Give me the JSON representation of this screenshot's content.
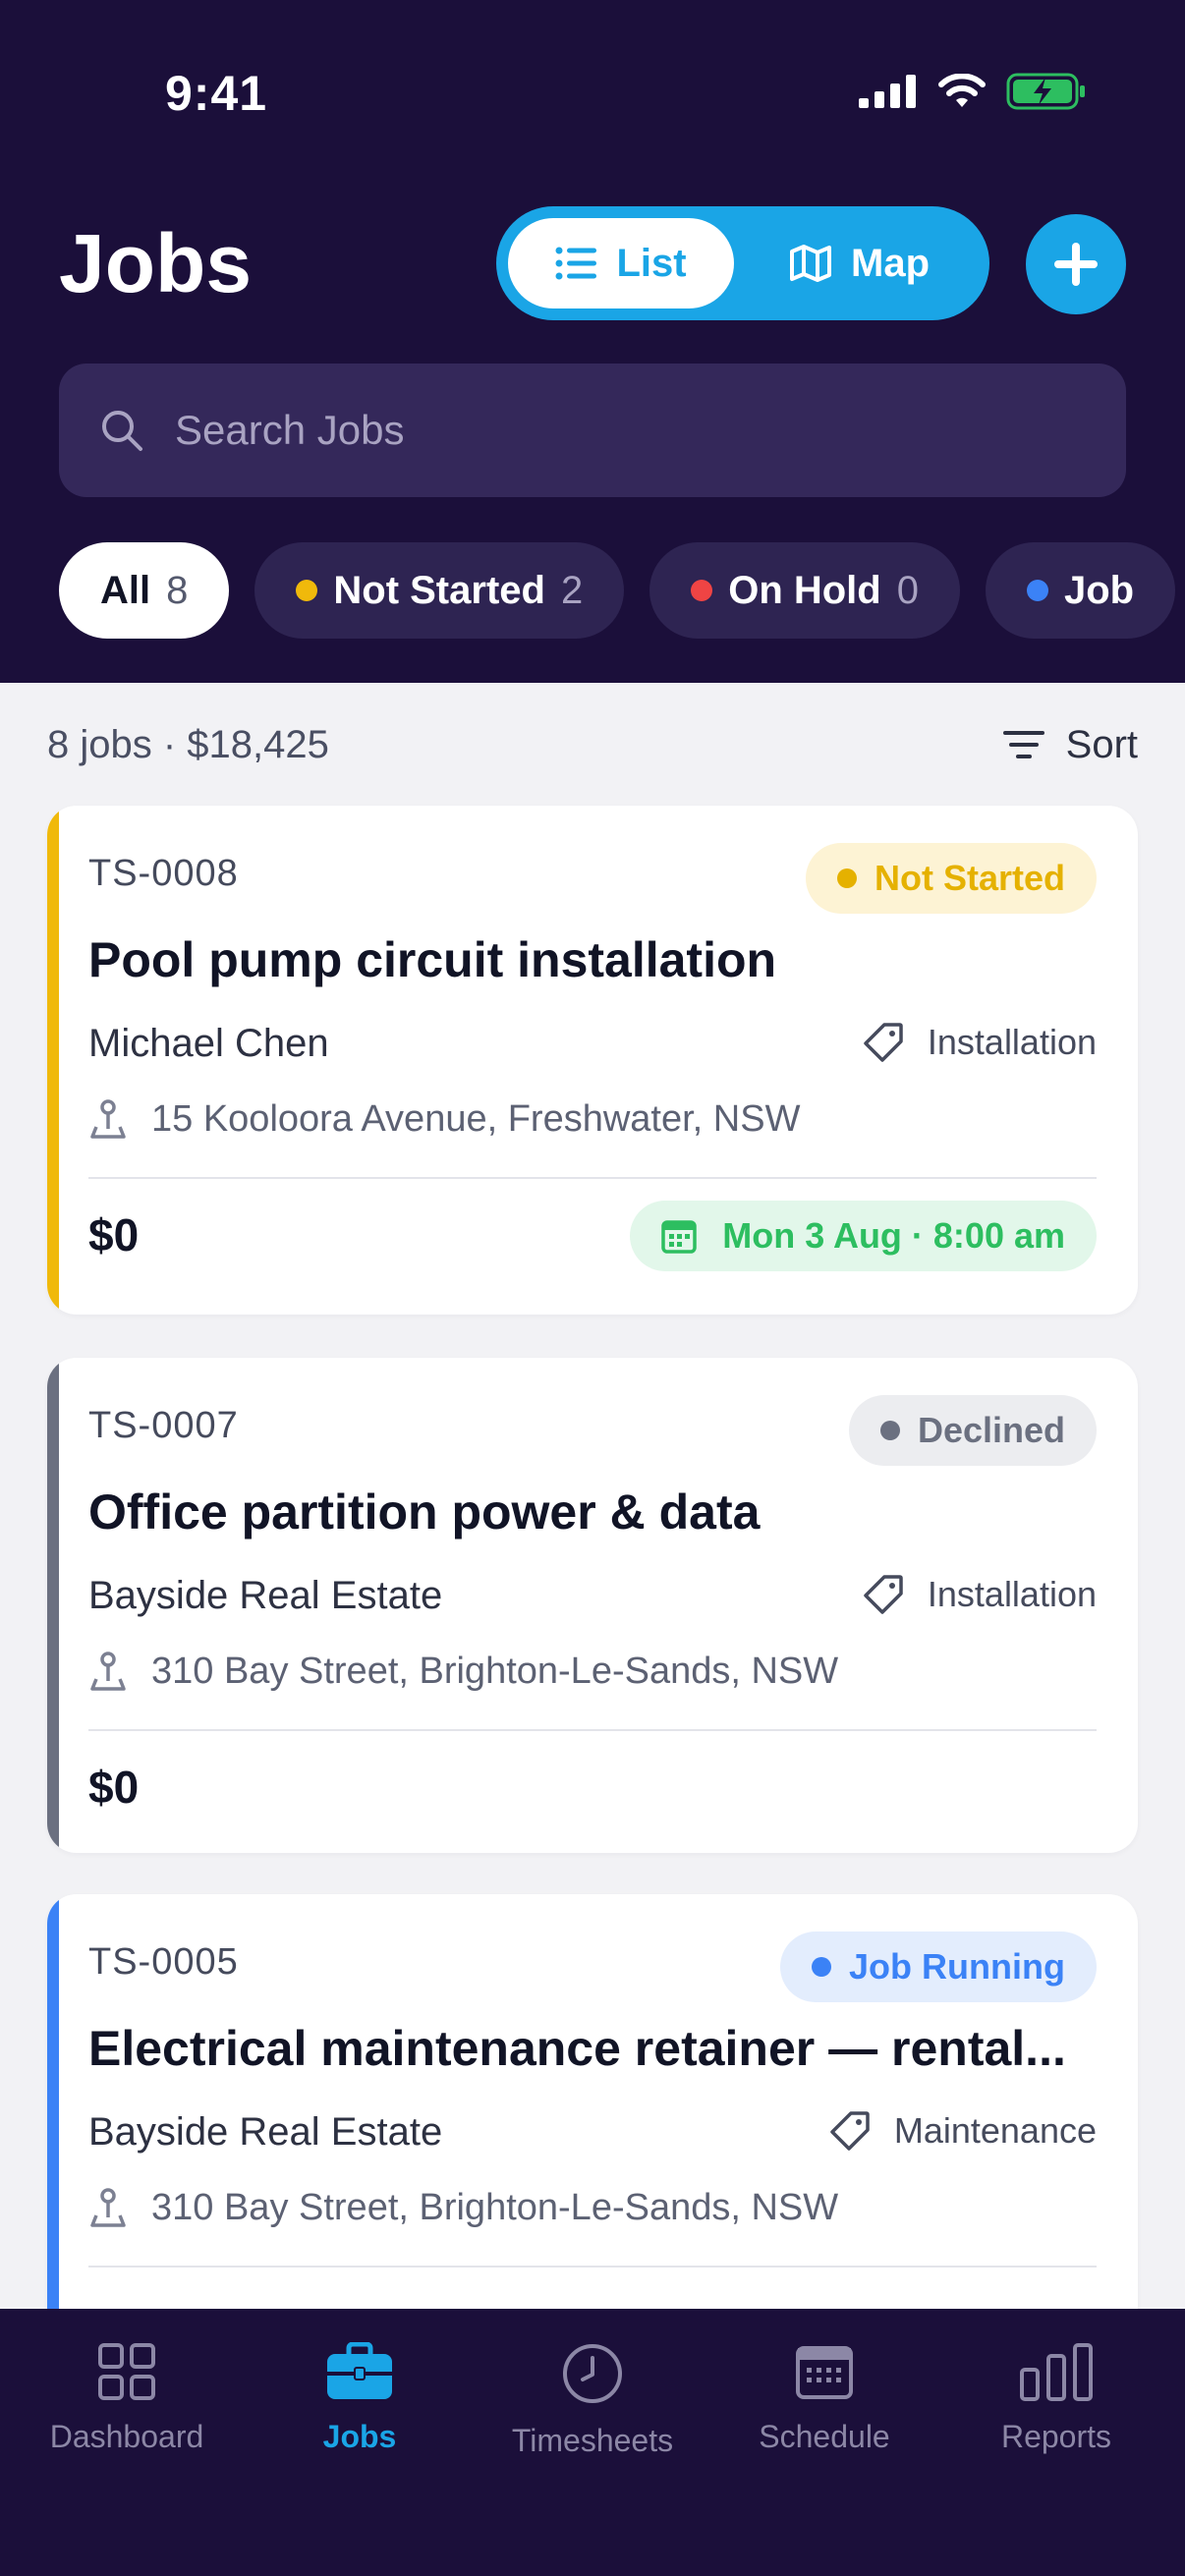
{
  "status_bar": {
    "time": "9:41"
  },
  "header": {
    "title": "Jobs",
    "view_toggle": {
      "list_label": "List",
      "map_label": "Map",
      "selected": "List"
    },
    "search": {
      "placeholder": "Search Jobs"
    }
  },
  "filters": [
    {
      "label": "All",
      "count": "8",
      "active": true,
      "dot_color": ""
    },
    {
      "label": "Not Started",
      "count": "2",
      "active": false,
      "dot_color": "#F0B90B"
    },
    {
      "label": "On Hold",
      "count": "0",
      "active": false,
      "dot_color": "#EF4444"
    },
    {
      "label": "Job",
      "count": "",
      "active": false,
      "dot_color": "#3B82F6"
    }
  ],
  "summary": {
    "text": "8 jobs · $18,425",
    "sort_label": "Sort"
  },
  "jobs": [
    {
      "id": "TS-0008",
      "status": "Not Started",
      "status_color": "#E5B100",
      "status_bg": "#FDF3D4",
      "accent_color": "#F0B90B",
      "title": "Pool pump circuit installation",
      "client": "Michael Chen",
      "category": "Installation",
      "address": "15 Kooloora Avenue, Freshwater, NSW",
      "price": "$0",
      "date": "Mon 3 Aug · 8:00 am"
    },
    {
      "id": "TS-0007",
      "status": "Declined",
      "status_color": "#6B7080",
      "status_bg": "#ECEDF0",
      "accent_color": "#6B7080",
      "title": "Office partition power & data",
      "client": "Bayside Real Estate",
      "category": "Installation",
      "address": "310 Bay Street, Brighton-Le-Sands, NSW",
      "price": "$0",
      "date": ""
    },
    {
      "id": "TS-0005",
      "status": "Job Running",
      "status_color": "#3B82F6",
      "status_bg": "#E3EDFD",
      "accent_color": "#3B82F6",
      "title": "Electrical maintenance retainer — rental...",
      "client": "Bayside Real Estate",
      "category": "Maintenance",
      "address": "310 Bay Street, Brighton-Le-Sands, NSW",
      "price": "",
      "date": ""
    }
  ],
  "tabbar": {
    "items": [
      {
        "label": "Dashboard",
        "icon": "grid-icon",
        "active": false
      },
      {
        "label": "Jobs",
        "icon": "briefcase-icon",
        "active": true
      },
      {
        "label": "Timesheets",
        "icon": "clock-icon",
        "active": false
      },
      {
        "label": "Schedule",
        "icon": "calendar-icon",
        "active": false
      },
      {
        "label": "Reports",
        "icon": "bar-chart-icon",
        "active": false
      }
    ]
  },
  "colors": {
    "header_bg": "#1B0F3A",
    "accent": "#1AA5E6",
    "page_bg": "#F2F2F5"
  }
}
